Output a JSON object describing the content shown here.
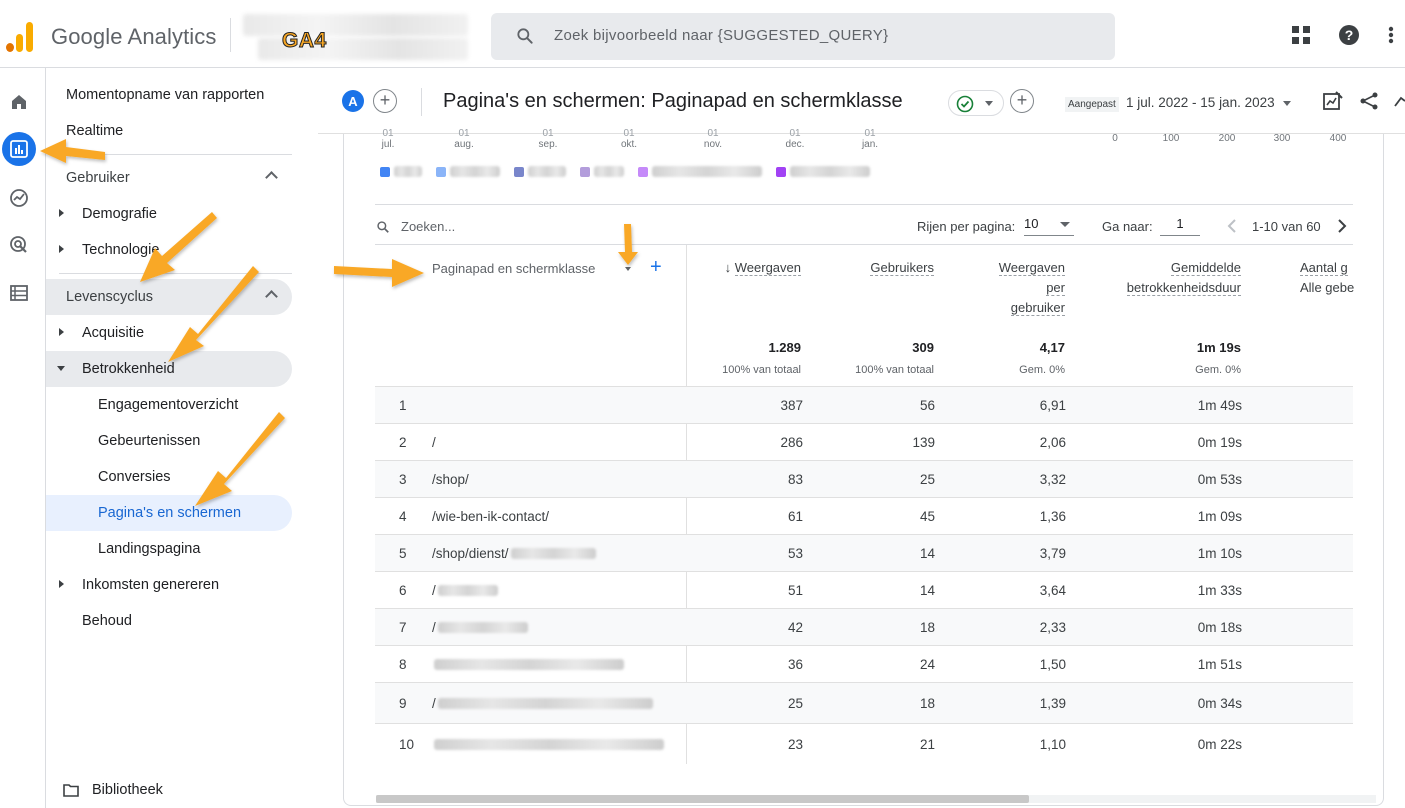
{
  "app": {
    "brand": "Google Analytics",
    "property_tag": "GA4",
    "search_placeholder": "Zoek bijvoorbeeld naar {SUGGESTED_QUERY}",
    "brand_colors": {
      "orange": "#f9ab00",
      "dark_orange": "#e37400",
      "blue": "#1a73e8",
      "annotation_arrow": "#f9a825"
    }
  },
  "rail": {
    "items": [
      "home-icon",
      "reports-icon",
      "explore-icon",
      "advertising-icon",
      "configure-icon"
    ],
    "active": "reports-icon"
  },
  "nav": {
    "snapshot": "Momentopname van rapporten",
    "realtime": "Realtime",
    "user_section": "Gebruiker",
    "demographics": "Demografie",
    "technology": "Technologie",
    "lifecycle_section": "Levenscyclus",
    "acquisition": "Acquisitie",
    "engagement": "Betrokkenheid",
    "engagement_overview": "Engagementoverzicht",
    "events": "Gebeurtenissen",
    "conversions": "Conversies",
    "pages_screens": "Pagina's en schermen",
    "landing_page": "Landingspagina",
    "monetization": "Inkomsten genereren",
    "retention": "Behoud",
    "library": "Bibliotheek"
  },
  "header": {
    "avatar_letter": "A",
    "title": "Pagina's en schermen: Paginapad en schermklasse",
    "date_label": "Aangepast",
    "date_range": "1 jul. 2022 - 15 jan. 2023"
  },
  "chart_axis": {
    "x_ticks": [
      {
        "day": "01",
        "month": "jul."
      },
      {
        "day": "01",
        "month": "aug."
      },
      {
        "day": "01",
        "month": "sep."
      },
      {
        "day": "01",
        "month": "okt."
      },
      {
        "day": "01",
        "month": "nov."
      },
      {
        "day": "01",
        "month": "dec."
      },
      {
        "day": "01",
        "month": "jan."
      }
    ],
    "bar_ticks": [
      "0",
      "100",
      "200",
      "300",
      "400"
    ],
    "legend_colors": [
      "#4285f4",
      "#8ab4f8",
      "#7986cb",
      "#b39ddb",
      "#c58af9",
      "#a142f4"
    ]
  },
  "toolbar": {
    "search_placeholder": "Zoeken...",
    "rows_label": "Rijen per pagina:",
    "rows_value": "10",
    "goto_label": "Ga naar:",
    "goto_value": "1",
    "range": "1-10 van 60"
  },
  "table": {
    "dimension_header": "Paginapad en schermklasse",
    "columns": [
      {
        "label": "Weergaven",
        "sorted": true,
        "total": "1.289",
        "sub": "100% van totaal"
      },
      {
        "label": "Gebruikers",
        "total": "309",
        "sub": "100% van totaal"
      },
      {
        "label_lines": [
          "Weergaven",
          "per",
          "gebruiker"
        ],
        "total": "4,17",
        "sub": "Gem. 0%"
      },
      {
        "label_lines": [
          "Gemiddelde",
          "betrokkenheidsduur"
        ],
        "total": "1m 19s",
        "sub": "Gem. 0%"
      },
      {
        "label_lines": [
          "Aantal g",
          "Alle gebe"
        ]
      }
    ],
    "rows": [
      {
        "n": "1",
        "path": "",
        "views": "387",
        "users": "56",
        "vpu": "6,91",
        "dur": "1m 49s"
      },
      {
        "n": "2",
        "path": "/",
        "views": "286",
        "users": "139",
        "vpu": "2,06",
        "dur": "0m 19s"
      },
      {
        "n": "3",
        "path": "/shop/",
        "views": "83",
        "users": "25",
        "vpu": "3,32",
        "dur": "0m 53s"
      },
      {
        "n": "4",
        "path": "/wie-ben-ik-contact/",
        "views": "61",
        "users": "45",
        "vpu": "1,36",
        "dur": "1m 09s"
      },
      {
        "n": "5",
        "path": "/shop/dienst/",
        "views": "53",
        "users": "14",
        "vpu": "3,79",
        "dur": "1m 10s"
      },
      {
        "n": "6",
        "path": "/",
        "views": "51",
        "users": "14",
        "vpu": "3,64",
        "dur": "1m 33s"
      },
      {
        "n": "7",
        "path": "/",
        "views": "42",
        "users": "18",
        "vpu": "2,33",
        "dur": "0m 18s"
      },
      {
        "n": "8",
        "path": "",
        "views": "36",
        "users": "24",
        "vpu": "1,50",
        "dur": "1m 51s"
      },
      {
        "n": "9",
        "path": "/",
        "views": "25",
        "users": "18",
        "vpu": "1,39",
        "dur": "0m 34s"
      },
      {
        "n": "10",
        "path": "",
        "views": "23",
        "users": "21",
        "vpu": "1,10",
        "dur": "0m 22s"
      }
    ]
  }
}
